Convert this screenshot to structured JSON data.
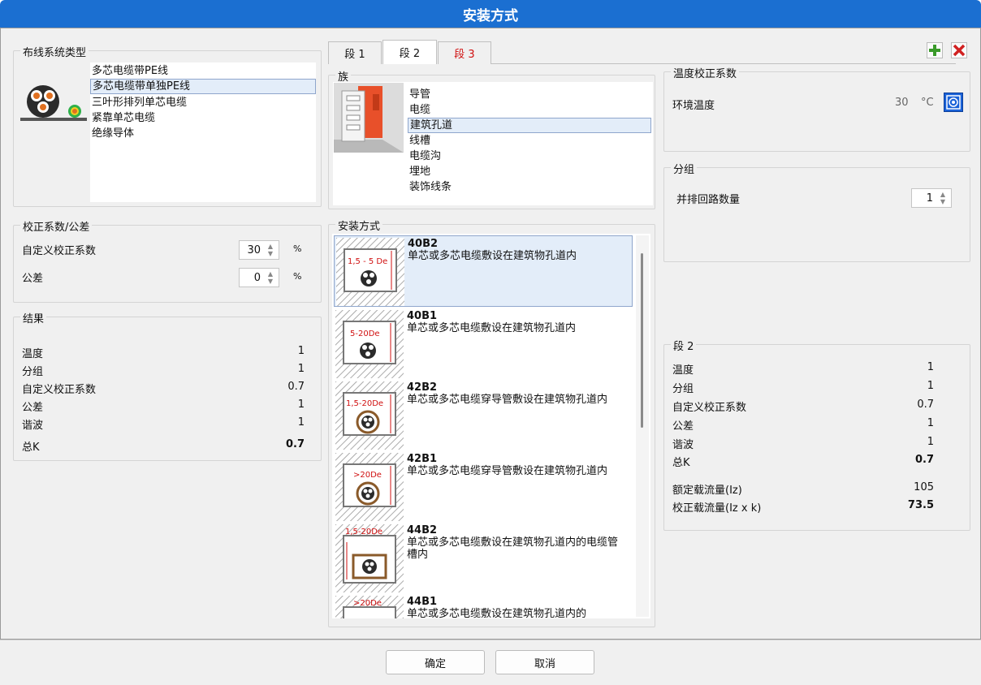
{
  "window": {
    "title": "安装方式"
  },
  "wiring": {
    "title": "布线系统类型",
    "items": [
      "多芯电缆带PE线",
      "多芯电缆带单独PE线",
      "三叶形排列单芯电缆",
      "紧靠单芯电缆",
      "绝缘导体"
    ],
    "selected_index": 1
  },
  "correction": {
    "title": "校正系数/公差",
    "custom_label": "自定义校正系数",
    "custom_value": "30",
    "tolerance_label": "公差",
    "tolerance_value": "0",
    "unit": "%"
  },
  "result": {
    "title": "结果",
    "rows": [
      {
        "label": "温度",
        "value": "1"
      },
      {
        "label": "分组",
        "value": "1"
      },
      {
        "label": "自定义校正系数",
        "value": "0.7"
      },
      {
        "label": "公差",
        "value": "1"
      },
      {
        "label": "谐波",
        "value": "1"
      },
      {
        "label": "总K",
        "value": "0.7"
      }
    ]
  },
  "tabs": [
    {
      "label": "段 1",
      "active": false,
      "color": "#111111"
    },
    {
      "label": "段 2",
      "active": true,
      "color": "#111111"
    },
    {
      "label": "段 3",
      "active": false,
      "color": "#d01010"
    }
  ],
  "family": {
    "title": "族",
    "items": [
      "导管",
      "电缆",
      "建筑孔道",
      "线槽",
      "电缆沟",
      "埋地",
      "装饰线条"
    ],
    "selected_index": 2
  },
  "install": {
    "title": "安装方式",
    "items": [
      {
        "code": "40B2",
        "desc": "单芯或多芯电缆敷设在建筑物孔道内",
        "dim": "1,5 - 5 De"
      },
      {
        "code": "40B1",
        "desc": "单芯或多芯电缆敷设在建筑物孔道内",
        "dim": "5-20De"
      },
      {
        "code": "42B2",
        "desc": "单芯或多芯电缆穿导管敷设在建筑物孔道内",
        "dim": "1,5-20De"
      },
      {
        "code": "42B1",
        "desc": "单芯或多芯电缆穿导管敷设在建筑物孔道内",
        "dim": ">20De"
      },
      {
        "code": "44B2",
        "desc": "单芯或多芯电缆敷设在建筑物孔道内的电缆管槽内",
        "dim": "1,5-20De"
      },
      {
        "code": "44B1",
        "desc": "单芯或多芯电缆敷设在建筑物孔道内的",
        "dim": ">20De"
      }
    ],
    "selected_index": 0
  },
  "temperature": {
    "title": "温度校正系数",
    "label": "环境温度",
    "value": "30",
    "unit": "°C"
  },
  "grouping": {
    "title": "分组",
    "label": "并排回路数量",
    "value": "1"
  },
  "segment": {
    "title": "段 2",
    "rows": [
      {
        "label": "温度",
        "value": "1"
      },
      {
        "label": "分组",
        "value": "1"
      },
      {
        "label": "自定义校正系数",
        "value": "0.7"
      },
      {
        "label": "公差",
        "value": "1"
      },
      {
        "label": "谐波",
        "value": "1"
      },
      {
        "label": "总K",
        "value": "0.7"
      }
    ],
    "iz_label": "额定载流量(Iz)",
    "iz_value": "105",
    "izk_label": "校正载流量(Iz x k)",
    "izk_value": "73.5"
  },
  "buttons": {
    "ok": "确定",
    "cancel": "取消"
  },
  "colors": {
    "title_bar": "#1b6fd1",
    "selection": "#e3edf9",
    "add_icon": "#3a9a2a",
    "remove_icon": "#d02020"
  }
}
